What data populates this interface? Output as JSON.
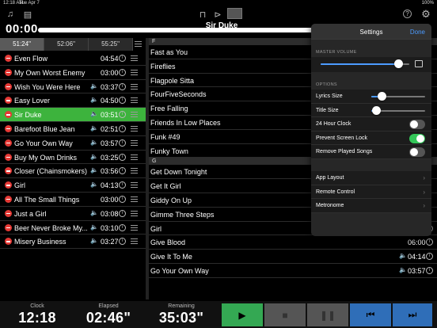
{
  "status": {
    "time": "12:18 AM",
    "date": "Tue Apr 7",
    "battery": "100%"
  },
  "toolbar": {
    "music_icon": "♫",
    "doc_icon": "▤",
    "lock_icon": "⊓",
    "forward_icon": "⊳",
    "help_icon": "?",
    "gear_icon": "⚙"
  },
  "now_playing": {
    "timer": "00:00",
    "title": "Sir Duke"
  },
  "segments": [
    "51:24\"",
    "52:06\"",
    "55:25\""
  ],
  "setlist": [
    {
      "name": "Even Flow",
      "duration": "04:54",
      "audio": false,
      "active": false
    },
    {
      "name": "My Own Worst Enemy",
      "duration": "03:00",
      "audio": false,
      "active": false
    },
    {
      "name": "Wish You Were Here",
      "duration": "03:37",
      "audio": true,
      "active": false
    },
    {
      "name": "Easy Lover",
      "duration": "04:50",
      "audio": true,
      "active": false
    },
    {
      "name": "Sir Duke",
      "duration": "03:51",
      "audio": true,
      "active": true
    },
    {
      "name": "Barefoot Blue Jean",
      "duration": "02:51",
      "audio": true,
      "active": false
    },
    {
      "name": "Go Your Own Way",
      "duration": "03:57",
      "audio": true,
      "active": false
    },
    {
      "name": "Buy My Own Drinks",
      "duration": "03:25",
      "audio": true,
      "active": false
    },
    {
      "name": "Closer (Chainsmokers)",
      "duration": "03:56",
      "audio": true,
      "active": false
    },
    {
      "name": "Girl",
      "duration": "04:13",
      "audio": true,
      "active": false
    },
    {
      "name": "All The Small Things",
      "duration": "03:00",
      "audio": false,
      "active": false
    },
    {
      "name": "Just a Girl",
      "duration": "03:08",
      "audio": true,
      "active": false
    },
    {
      "name": "Beer Never Broke My...",
      "duration": "03:10",
      "audio": true,
      "active": false
    },
    {
      "name": "Misery Business",
      "duration": "03:27",
      "audio": true,
      "active": false
    }
  ],
  "library": {
    "section_f": "F",
    "f_items": [
      {
        "name": "Fast as You",
        "duration": ""
      },
      {
        "name": "Fireflies",
        "duration": ""
      },
      {
        "name": "Flagpole Sitta",
        "duration": ""
      },
      {
        "name": "FourFiveSeconds",
        "duration": ""
      },
      {
        "name": "Free Falling",
        "duration": ""
      },
      {
        "name": "Friends In Low Places",
        "duration": ""
      },
      {
        "name": "Funk #49",
        "duration": ""
      },
      {
        "name": "Funky Town",
        "duration": ""
      }
    ],
    "section_g": "G",
    "g_items": [
      {
        "name": "Get Down Tonight",
        "duration": ""
      },
      {
        "name": "Get It Girl",
        "duration": ""
      },
      {
        "name": "Giddy On Up",
        "duration": ""
      },
      {
        "name": "Gimme Three Steps",
        "duration": ""
      },
      {
        "name": "Girl",
        "duration": "04:13",
        "audio": true
      },
      {
        "name": "Give Blood",
        "duration": "06:00"
      },
      {
        "name": "Give It To Me",
        "duration": "04:14",
        "audio": true
      },
      {
        "name": "Go Your Own Way",
        "duration": "03:57",
        "audio": true
      }
    ]
  },
  "settings": {
    "title": "Settings",
    "done": "Done",
    "master_volume_label": "MASTER VOLUME",
    "master_volume": 0.88,
    "options_label": "OPTIONS",
    "lyrics_size_label": "Lyrics Size",
    "lyrics_size": 0.2,
    "title_size_label": "Title Size",
    "title_size": 0.1,
    "hour24_label": "24 Hour Clock",
    "hour24": false,
    "prevent_lock_label": "Prevent Screen Lock",
    "prevent_lock": true,
    "remove_played_label": "Remove Played Songs",
    "remove_played": false,
    "app_layout": "App Layout",
    "remote_control": "Remote Control",
    "metronome": "Metronome"
  },
  "bottom": {
    "clock_label": "Clock",
    "clock_value": "12:18",
    "elapsed_label": "Elapsed",
    "elapsed_value": "02:46\"",
    "remaining_label": "Remaining",
    "remaining_value": "35:03\""
  },
  "colors": {
    "active_row": "#3db33d",
    "play": "#34a853",
    "skip": "#2f6eb8",
    "accent": "#4c9bff",
    "minus": "#e53935"
  }
}
